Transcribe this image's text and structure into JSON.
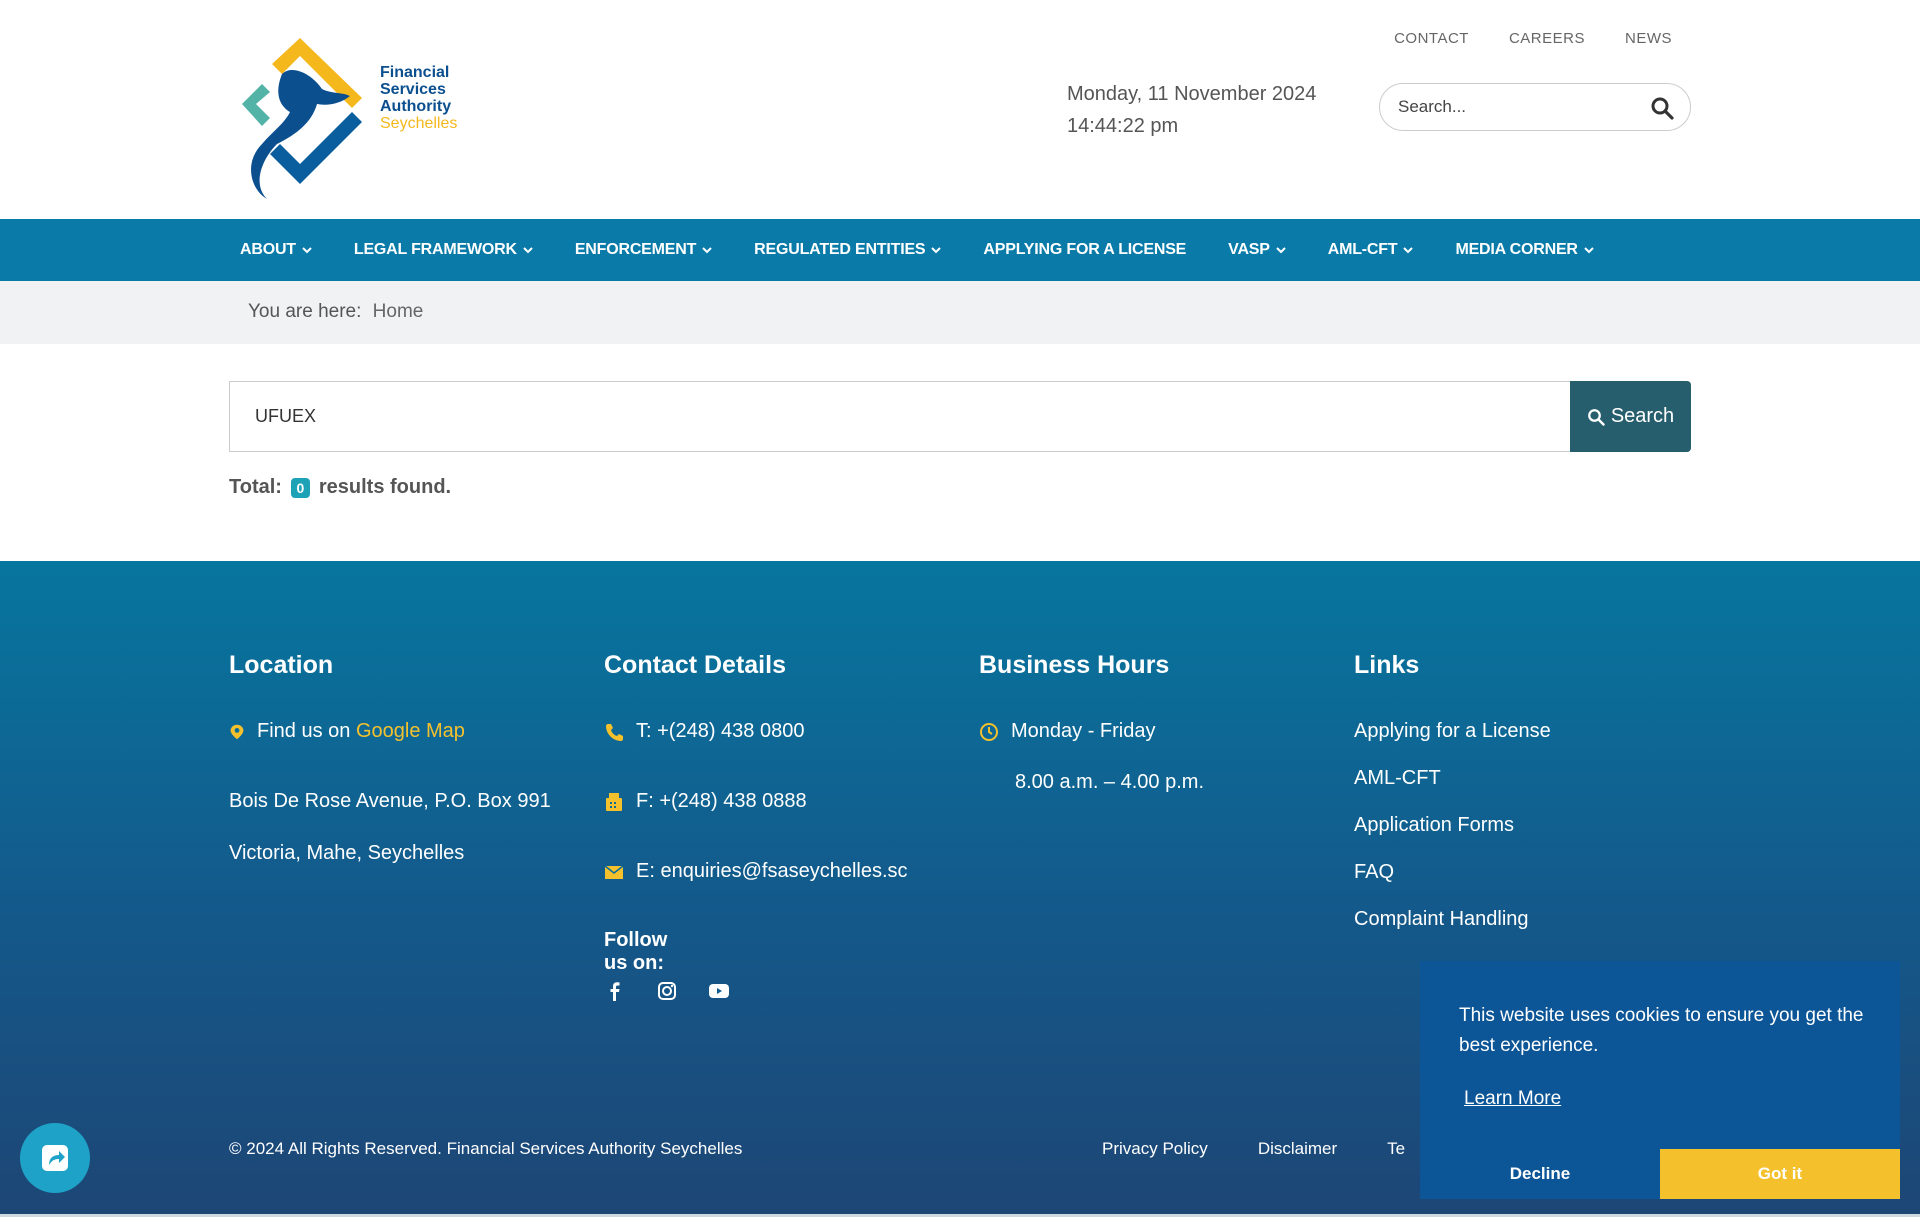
{
  "logo": {
    "line1": "Financial",
    "line2": "Services",
    "line3": "Authority",
    "line4": "Seychelles"
  },
  "top_links": [
    "CONTACT",
    "CAREERS",
    "NEWS"
  ],
  "datetime": {
    "date": "Monday, 11 November 2024",
    "time": "14:44:22 pm"
  },
  "header_search": {
    "placeholder": "Search..."
  },
  "nav": [
    {
      "label": "ABOUT",
      "dropdown": true
    },
    {
      "label": "LEGAL FRAMEWORK",
      "dropdown": true
    },
    {
      "label": "ENFORCEMENT",
      "dropdown": true
    },
    {
      "label": "REGULATED ENTITIES",
      "dropdown": true
    },
    {
      "label": "APPLYING FOR A LICENSE",
      "dropdown": false
    },
    {
      "label": "VASP",
      "dropdown": true
    },
    {
      "label": "AML-CFT",
      "dropdown": true
    },
    {
      "label": "MEDIA CORNER",
      "dropdown": true
    }
  ],
  "breadcrumb": {
    "prefix": "You are here:",
    "home": "Home"
  },
  "search": {
    "value": "UFUEX",
    "button": "Search"
  },
  "results": {
    "prefix": "Total:",
    "count": "0",
    "suffix": "results found."
  },
  "footer": {
    "location": {
      "title": "Location",
      "find": "Find us on",
      "map_link": "Google Map",
      "addr1": "Bois De Rose Avenue, P.O. Box 991",
      "addr2": "Victoria, Mahe, Seychelles"
    },
    "contact": {
      "title": "Contact Details",
      "phone": "T: +(248) 438 0800",
      "fax": "F: +(248) 438 0888",
      "email": "E: enquiries@fsaseychelles.sc",
      "follow": "Follow us on:"
    },
    "hours": {
      "title": "Business Hours",
      "days": "Monday - Friday",
      "time": "8.00 a.m. – 4.00 p.m."
    },
    "links": {
      "title": "Links",
      "items": [
        "Applying for a License",
        "AML-CFT",
        "Application Forms",
        "FAQ",
        "Complaint Handling"
      ]
    },
    "copyright": "© 2024 All Rights Reserved. Financial Services Authority Seychelles",
    "bottom_links": [
      "Privacy Policy",
      "Disclaimer",
      "Te"
    ]
  },
  "cookie": {
    "message": "This website uses cookies to ensure you get the best experience.",
    "learn_more": "Learn More",
    "decline": "Decline",
    "accept": "Got it"
  },
  "colors": {
    "nav": "#0a7ba8",
    "accent": "#f4c12d",
    "search_button": "#275e6e",
    "cookie_bg": "#0c5596"
  }
}
